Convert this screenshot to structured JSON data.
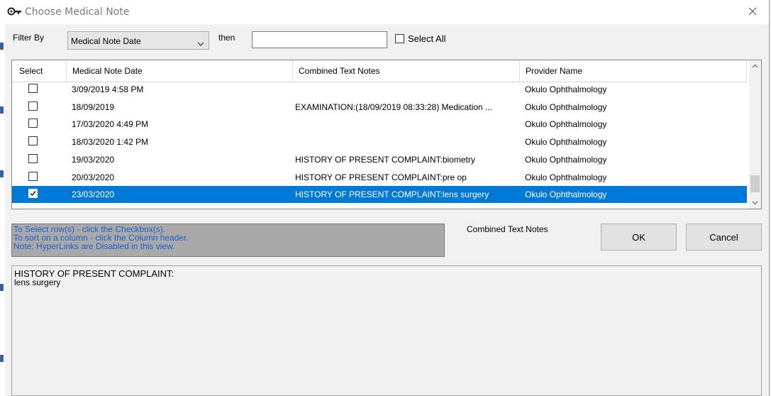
{
  "dialog": {
    "title": "Choose Medical Note",
    "icons": {
      "app": "key-icon",
      "close": "close-icon"
    }
  },
  "filter": {
    "label": "Filter By",
    "selected": "Medical Note Date",
    "then_label": "then",
    "then_value": "",
    "select_all_label": "Select All",
    "select_all_checked": false
  },
  "grid": {
    "columns": [
      "Select",
      "Medical Note Date",
      "Combined Text Notes",
      "Provider Name"
    ],
    "rows": [
      {
        "checked": false,
        "date": "3/09/2019 4:58 PM",
        "notes": "",
        "provider": "Okulo Ophthalmology"
      },
      {
        "checked": false,
        "date": "18/09/2019",
        "notes": "EXAMINATION:(18/09/2019 08:33:28) Medication ...",
        "provider": "Okulo Ophthalmology"
      },
      {
        "checked": false,
        "date": "17/03/2020 4:49 PM",
        "notes": "",
        "provider": "Okulo Ophthalmology"
      },
      {
        "checked": false,
        "date": "18/03/2020 1:42 PM",
        "notes": "",
        "provider": "Okulo Ophthalmology"
      },
      {
        "checked": false,
        "date": "19/03/2020",
        "notes": "HISTORY OF PRESENT COMPLAINT:biometry",
        "provider": "Okulo Ophthalmology"
      },
      {
        "checked": false,
        "date": "20/03/2020",
        "notes": "HISTORY OF PRESENT COMPLAINT:pre op",
        "provider": "Okulo Ophthalmology"
      },
      {
        "checked": true,
        "date": "23/03/2020",
        "notes": "HISTORY OF PRESENT COMPLAINT:lens surgery",
        "provider": "Okulo Ophthalmology"
      }
    ],
    "selected_row": 6
  },
  "info": {
    "lines": [
      "To Select row(s) - click the Checkbox(s).",
      "To sort on a column - click the Column header.",
      "Note: HyperLinks are Disabled in this view."
    ],
    "color": "#1e5fcf"
  },
  "notes_panel": {
    "label": "Combined Text Notes",
    "heading": "HISTORY OF PRESENT COMPLAINT:",
    "body": "lens surgery"
  },
  "buttons": {
    "ok": "OK",
    "cancel": "Cancel"
  },
  "colors": {
    "selection": "#0078d7",
    "info_box": "#a9a9a9"
  }
}
